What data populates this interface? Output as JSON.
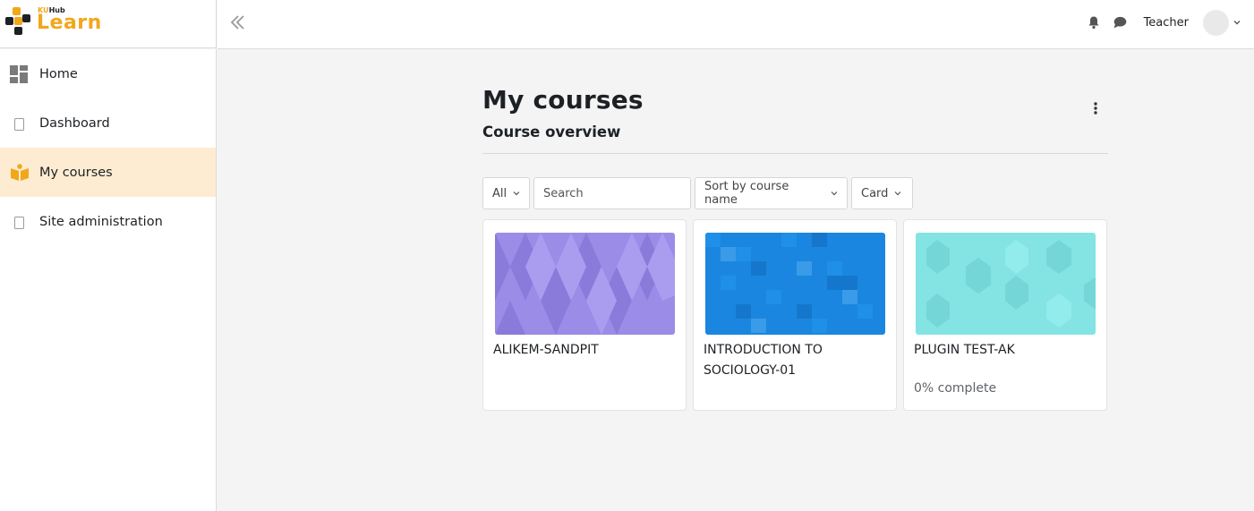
{
  "brand": {
    "small_ku": "KU",
    "small_hub": "Hub",
    "name": "Learn",
    "accent": "#f2a71b"
  },
  "header": {
    "username": "Teacher"
  },
  "sidebar": {
    "items": [
      {
        "label": "Home",
        "icon": "dashboard-grid-icon"
      },
      {
        "label": "Dashboard",
        "icon": "page-icon"
      },
      {
        "label": "My courses",
        "icon": "open-book-icon",
        "active": true
      },
      {
        "label": "Site administration",
        "icon": "page-icon"
      }
    ]
  },
  "main": {
    "title": "My courses",
    "section_title": "Course overview",
    "filters": {
      "grouping": "All",
      "search_placeholder": "Search",
      "sort": "Sort by course name",
      "view": "Card"
    },
    "courses": [
      {
        "name": "ALIKEM-SANDPIT",
        "progress": "",
        "pattern": "diamonds",
        "color": "#9b8ce8"
      },
      {
        "name": "INTRODUCTION TO SOCIOLOGY-01",
        "progress": "",
        "pattern": "squares",
        "color": "#1a86e0"
      },
      {
        "name": "PLUGIN TEST-AK",
        "progress": "0% complete",
        "pattern": "hexagons",
        "color": "#84e3e3"
      }
    ]
  }
}
